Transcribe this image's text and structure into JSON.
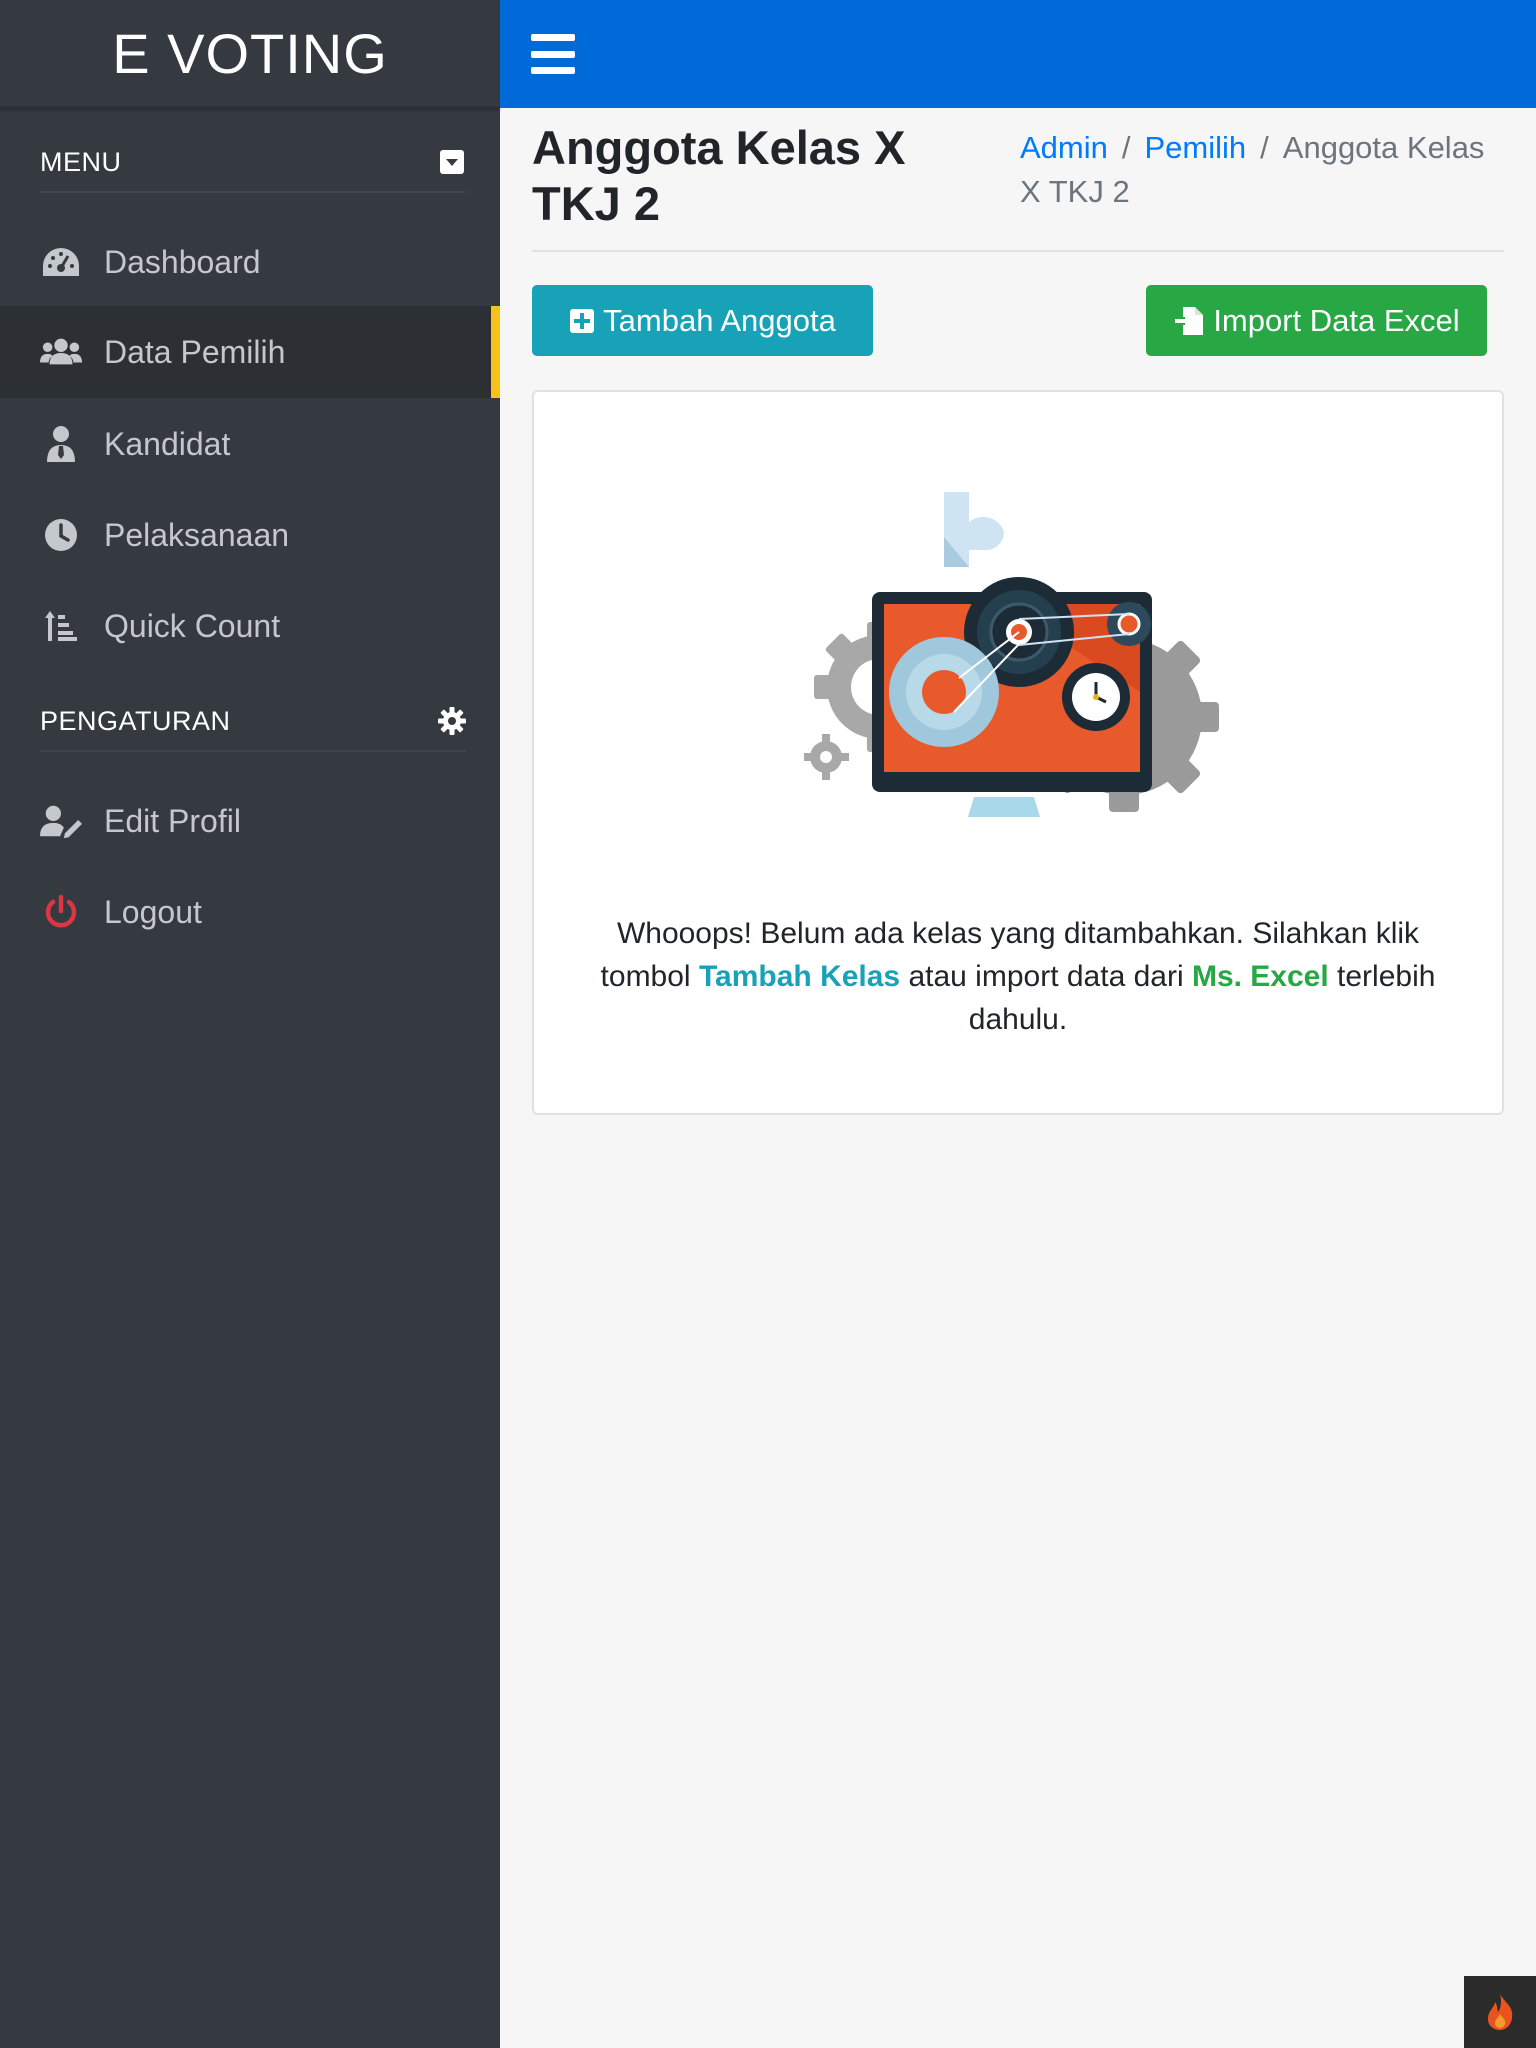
{
  "app": {
    "brand": "E VOTING"
  },
  "sidebar": {
    "menu_header": "MENU",
    "settings_header": "PENGATURAN",
    "menu_items": [
      {
        "label": "Dashboard",
        "icon": "dashboard-gauge-icon"
      },
      {
        "label": "Data Pemilih",
        "icon": "users-icon",
        "active": true
      },
      {
        "label": "Kandidat",
        "icon": "user-tie-icon"
      },
      {
        "label": "Pelaksanaan",
        "icon": "clock-icon"
      },
      {
        "label": "Quick Count",
        "icon": "sort-amount-up-icon"
      }
    ],
    "settings_items": [
      {
        "label": "Edit Profil",
        "icon": "user-edit-icon"
      },
      {
        "label": "Logout",
        "icon": "power-off-icon"
      }
    ]
  },
  "header": {
    "title": "Anggota Kelas X TKJ 2",
    "breadcrumb": [
      "Admin",
      "Pemilih",
      "Anggota Kelas X TKJ 2"
    ]
  },
  "actions": {
    "add_label": "Tambah Anggota",
    "import_label": "Import Data Excel"
  },
  "empty_state": {
    "text_1": "Whooops! Belum ada kelas yang ditambahkan. Silahkan klik tombol ",
    "highlight_1": "Tambah Kelas",
    "text_2": " atau import data dari ",
    "highlight_2": "Ms. Excel",
    "text_3": " terlebih dahulu."
  },
  "colors": {
    "sidebar_bg": "#343a40",
    "topbar_bg": "#006ad9",
    "active_accent": "#f9c21b",
    "info": "#17a2b8",
    "success": "#28a745",
    "logout_icon": "#dc3545"
  }
}
